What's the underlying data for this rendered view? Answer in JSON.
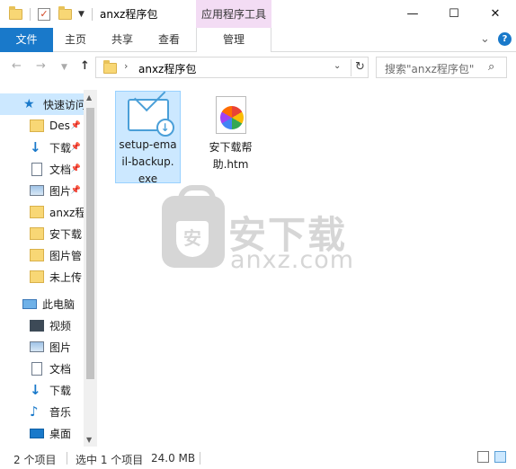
{
  "window": {
    "title": "anxz程序包",
    "context_tab_group": "应用程序工具",
    "minimize": "—",
    "maximize": "☐",
    "close": "✕"
  },
  "ribbon": {
    "tabs": [
      "文件",
      "主页",
      "共享",
      "查看"
    ],
    "context_tab": "管理",
    "expand_icon": "chevron-down-icon",
    "help_label": "?"
  },
  "address": {
    "path": "anxz程序包",
    "search_placeholder": "搜索\"anxz程序包\""
  },
  "nav": {
    "quick_access": "快速访问",
    "quick_items": [
      "Des",
      "下载",
      "文档",
      "图片",
      "anxz程",
      "安下载",
      "图片管",
      "未上传"
    ],
    "this_pc": "此电脑",
    "pc_items": [
      "视频",
      "图片",
      "文档",
      "下载",
      "音乐",
      "桌面"
    ]
  },
  "files": [
    {
      "name": "setup-email-backup.exe",
      "lines": [
        "setup-ema",
        "il-backup.",
        "exe"
      ],
      "selected": true,
      "icon": "email-backup-icon"
    },
    {
      "name": "安下载帮助.htm",
      "lines": [
        "安下载帮",
        "助.htm"
      ],
      "selected": false,
      "icon": "htm-file-icon"
    }
  ],
  "watermark": {
    "cn": "安下载",
    "en": "anxz.com",
    "badge": "安"
  },
  "status": {
    "count": "2 个项目",
    "selection": "选中 1 个项目",
    "size": "24.0 MB"
  },
  "colors": {
    "accent": "#1979ca",
    "selection": "#cce8ff",
    "context_tab": "#f3dcf4"
  }
}
